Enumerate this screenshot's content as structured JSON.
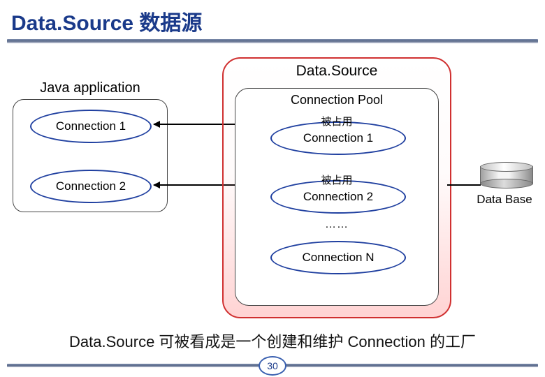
{
  "title": "Data.Source 数据源",
  "java_app": {
    "label": "Java application",
    "conns": [
      "Connection 1",
      "Connection 2"
    ]
  },
  "datasource": {
    "label": "Data.Source",
    "pool": {
      "label": "Connection Pool",
      "items": [
        {
          "status": "被占用",
          "name": "Connection 1"
        },
        {
          "status": "被占用",
          "name": "Connection 2"
        }
      ],
      "ellipsis": "……",
      "last": "Connection N"
    }
  },
  "database": {
    "label": "Data Base"
  },
  "caption": "Data.Source 可被看成是一个创建和维护 Connection 的工厂",
  "page": "30"
}
